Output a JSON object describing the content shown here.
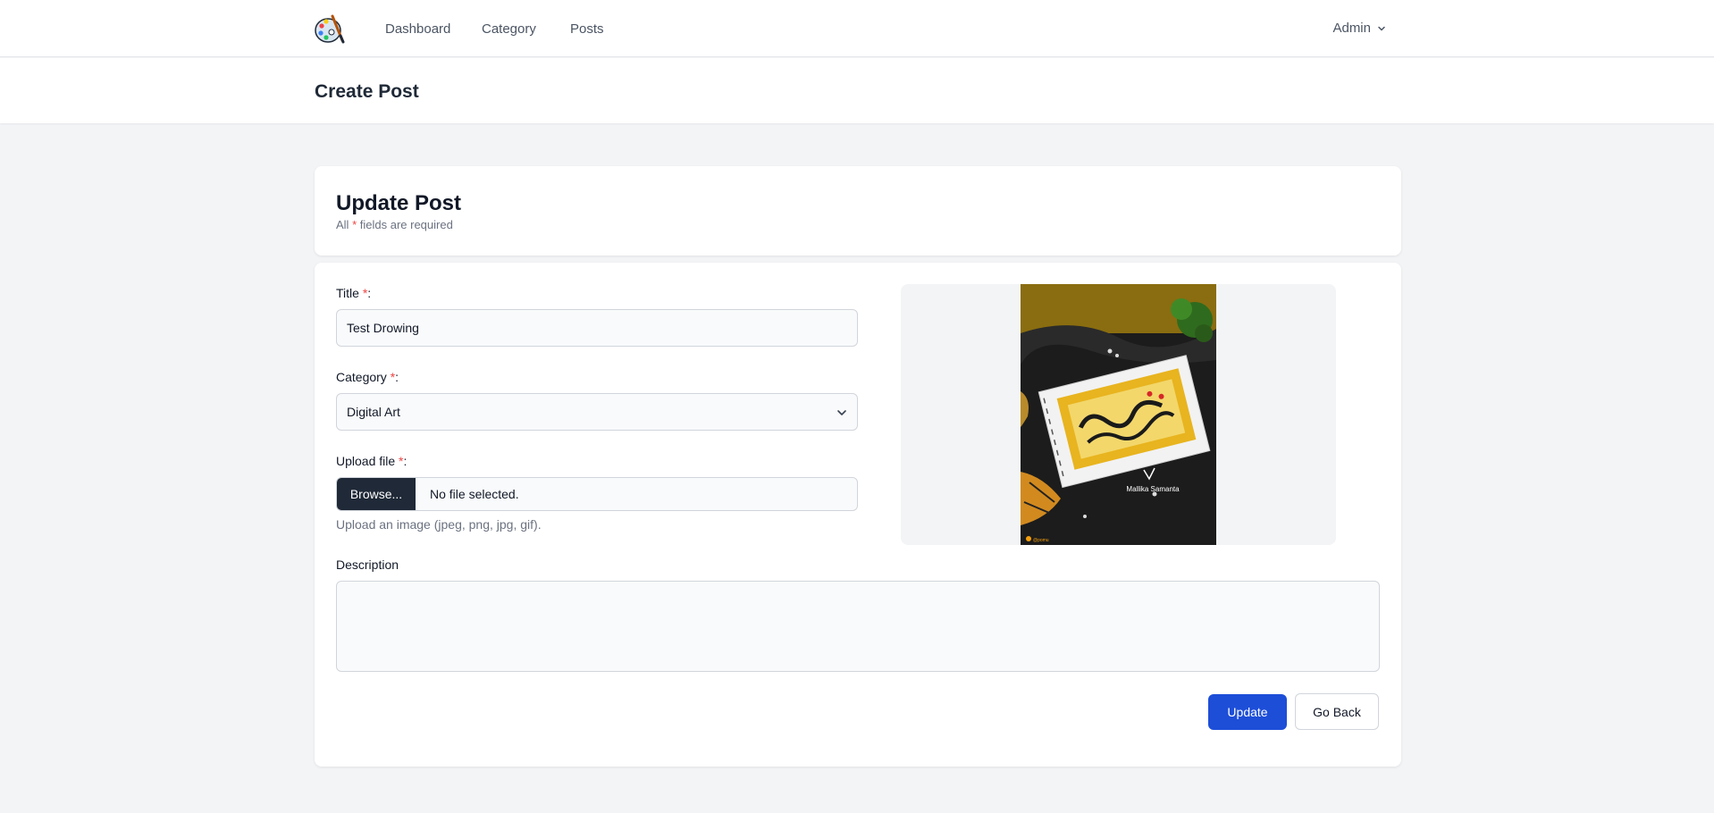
{
  "nav": {
    "links": [
      "Dashboard",
      "Category",
      "Posts"
    ],
    "user_menu": "Admin"
  },
  "page_header": {
    "title": "Create Post"
  },
  "form_header": {
    "title": "Update Post",
    "subtitle_prefix": "All",
    "subtitle_marker": "*",
    "subtitle_suffix": "fields are required"
  },
  "form": {
    "title": {
      "label": "Title",
      "required_marker": "*",
      "colon": ":",
      "value": "Test Drowing"
    },
    "category": {
      "label": "Category",
      "required_marker": "*",
      "colon": ":",
      "selected": "Digital Art"
    },
    "upload": {
      "label": "Upload file",
      "required_marker": "*",
      "colon": ":",
      "button": "Browse...",
      "status": "No file selected.",
      "hint": "Upload an image (jpeg, png, jpg, gif)."
    },
    "description": {
      "label": "Description",
      "value": ""
    },
    "preview": {
      "image": "artwork-preview-photo",
      "artist_text": "Mallika Samanta",
      "corner_tag": "@pomu"
    }
  },
  "actions": {
    "update": "Update",
    "back": "Go Back"
  },
  "colors": {
    "accent": "#1d4ed8",
    "required": "#ef4444",
    "browse_bg": "#1f2937",
    "page_bg": "#f3f4f6"
  }
}
